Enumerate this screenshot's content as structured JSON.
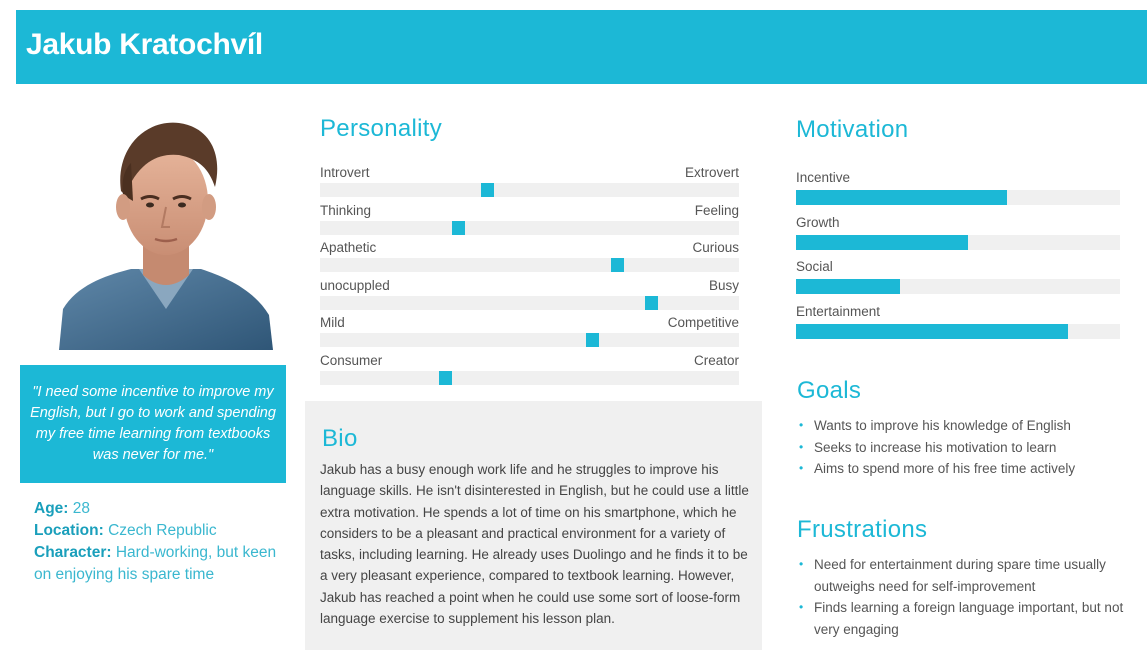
{
  "name": "Jakub Kratochvíl",
  "quote": "\"I need some incentive to improve my English, but I go to work and spending my free time learning from textbooks was never for me.\"",
  "info": {
    "age_label": "Age:",
    "age": "28",
    "location_label": "Location:",
    "location": "Czech Republic",
    "character_label": "Character:",
    "character": "Hard-working, but keen on enjoying his spare time"
  },
  "personality": {
    "title": "Personality",
    "traits": [
      {
        "left": "Introvert",
        "right": "Extrovert",
        "value": 0.4
      },
      {
        "left": "Thinking",
        "right": "Feeling",
        "value": 0.33
      },
      {
        "left": "Apathetic",
        "right": "Curious",
        "value": 0.71
      },
      {
        "left": "unocuppled",
        "right": "Busy",
        "value": 0.79
      },
      {
        "left": "Mild",
        "right": "Competitive",
        "value": 0.65
      },
      {
        "left": "Consumer",
        "right": "Creator",
        "value": 0.3
      }
    ]
  },
  "bio": {
    "title": "Bio",
    "text": "Jakub has a busy enough work life and he struggles to improve his language skills. He isn't disinterested in English, but he could use a little extra motivation. He spends a lot of time on his smartphone, which he considers to be a pleasant and practical environment for a variety of tasks, including learning. He already uses Duolingo and he finds it to be a very pleasant experience, compared to textbook learning. However, Jakub has reached a point when he could use some sort of loose-form language exercise to supplement his lesson plan."
  },
  "motivation": {
    "title": "Motivation",
    "items": [
      {
        "label": "Incentive",
        "value": 0.65
      },
      {
        "label": "Growth",
        "value": 0.53
      },
      {
        "label": "Social",
        "value": 0.32
      },
      {
        "label": "Entertainment",
        "value": 0.84
      }
    ]
  },
  "goals": {
    "title": "Goals",
    "items": [
      "Wants to improve his knowledge of English",
      "Seeks to increase his motivation to learn",
      "Aims to spend more of his free time actively"
    ]
  },
  "frustrations": {
    "title": "Frustrations",
    "items": [
      "Need for entertainment during spare time usually outweighs need for self-improvement",
      "Finds learning a foreign language important, but not very engaging"
    ]
  },
  "colors": {
    "accent": "#1cb8d6",
    "panel": "#f0f0f0"
  }
}
